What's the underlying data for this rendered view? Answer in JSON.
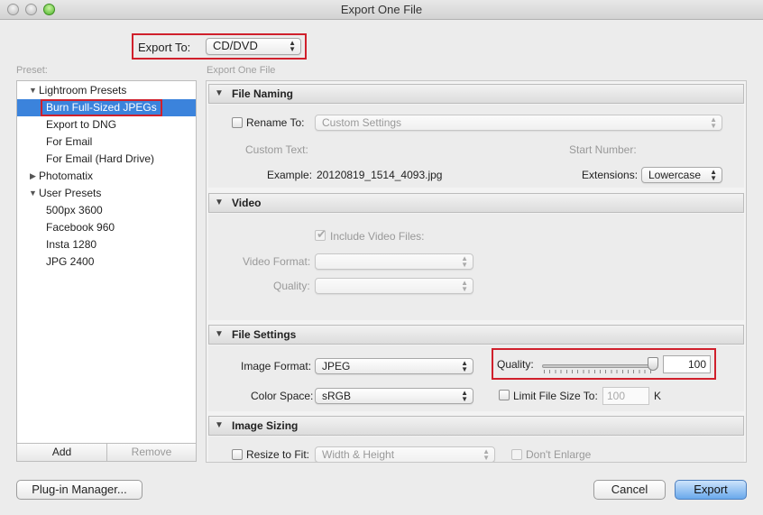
{
  "window": {
    "title": "Export One File"
  },
  "export_to": {
    "label": "Export To:",
    "value": "CD/DVD"
  },
  "preset": {
    "section_label": "Preset:",
    "groups": [
      {
        "label": "Lightroom Presets",
        "expanded": true,
        "items": [
          "Burn Full-Sized JPEGs",
          "Export to DNG",
          "For Email",
          "For Email (Hard Drive)"
        ]
      },
      {
        "label": "Photomatix",
        "expanded": false,
        "items": []
      },
      {
        "label": "User Presets",
        "expanded": true,
        "items": [
          "500px 3600",
          "Facebook 960",
          "Insta 1280",
          "JPG 2400"
        ]
      }
    ],
    "selected": "Burn Full-Sized JPEGs",
    "add_label": "Add",
    "remove_label": "Remove"
  },
  "panel_label": "Export One File",
  "file_naming": {
    "title": "File Naming",
    "rename_label": "Rename To:",
    "rename_value": "Custom Settings",
    "custom_text_label": "Custom Text:",
    "start_number_label": "Start Number:",
    "example_label": "Example:",
    "example_value": "20120819_1514_4093.jpg",
    "extensions_label": "Extensions:",
    "extensions_value": "Lowercase"
  },
  "video": {
    "title": "Video",
    "include_label": "Include Video Files:",
    "video_format_label": "Video Format:",
    "quality_label": "Quality:"
  },
  "file_settings": {
    "title": "File Settings",
    "image_format_label": "Image Format:",
    "image_format_value": "JPEG",
    "quality_label": "Quality:",
    "quality_value": "100",
    "color_space_label": "Color Space:",
    "color_space_value": "sRGB",
    "limit_label": "Limit File Size To:",
    "limit_value": "100",
    "limit_unit": "K"
  },
  "image_sizing": {
    "title": "Image Sizing",
    "resize_label": "Resize to Fit:",
    "resize_value": "Width & Height",
    "dont_enlarge_label": "Don't Enlarge"
  },
  "buttons": {
    "plugin_manager": "Plug-in Manager...",
    "cancel": "Cancel",
    "export": "Export"
  }
}
